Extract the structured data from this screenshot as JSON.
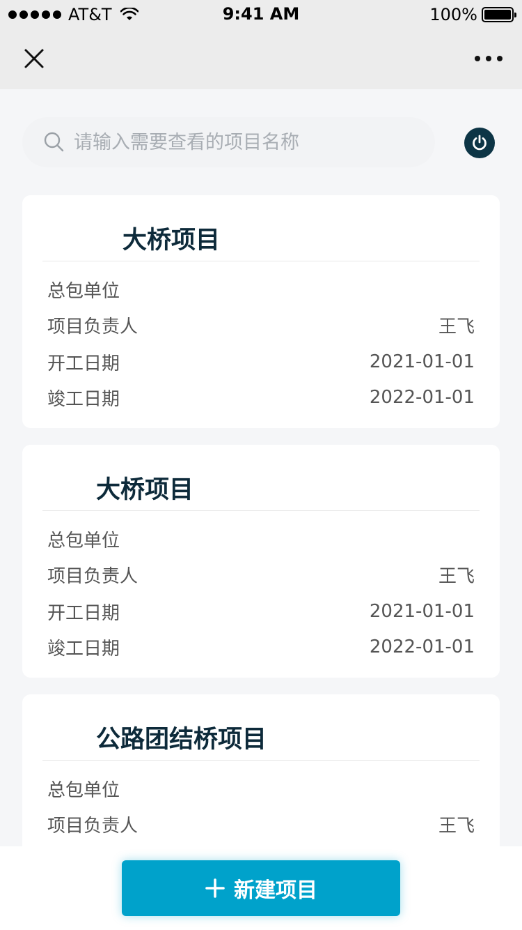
{
  "status_bar": {
    "carrier": "AT&T",
    "time": "9:41 AM",
    "battery": "100%"
  },
  "nav": {
    "close_icon": "close-icon",
    "more_icon": "more-icon"
  },
  "search": {
    "placeholder": "请输入需要查看的项目名称",
    "value": ""
  },
  "colors": {
    "accent": "#00a2cb",
    "title": "#0d2a3a",
    "power": "#0d3546"
  },
  "projects": [
    {
      "title": "大桥项目",
      "rows": [
        {
          "label": "总包单位",
          "value": ""
        },
        {
          "label": "项目负责人",
          "value": "王飞"
        },
        {
          "label": "开工日期",
          "value": "2021-01-01"
        },
        {
          "label": "竣工日期",
          "value": "2022-01-01"
        }
      ]
    },
    {
      "title": "大桥项目",
      "rows": [
        {
          "label": "总包单位",
          "value": ""
        },
        {
          "label": "项目负责人",
          "value": "王飞"
        },
        {
          "label": "开工日期",
          "value": "2021-01-01"
        },
        {
          "label": "竣工日期",
          "value": "2022-01-01"
        }
      ]
    },
    {
      "title": "公路团结桥项目",
      "rows": [
        {
          "label": "总包单位",
          "value": ""
        },
        {
          "label": "项目负责人",
          "value": "王飞"
        }
      ]
    }
  ],
  "footer": {
    "new_button_label": "新建项目"
  }
}
